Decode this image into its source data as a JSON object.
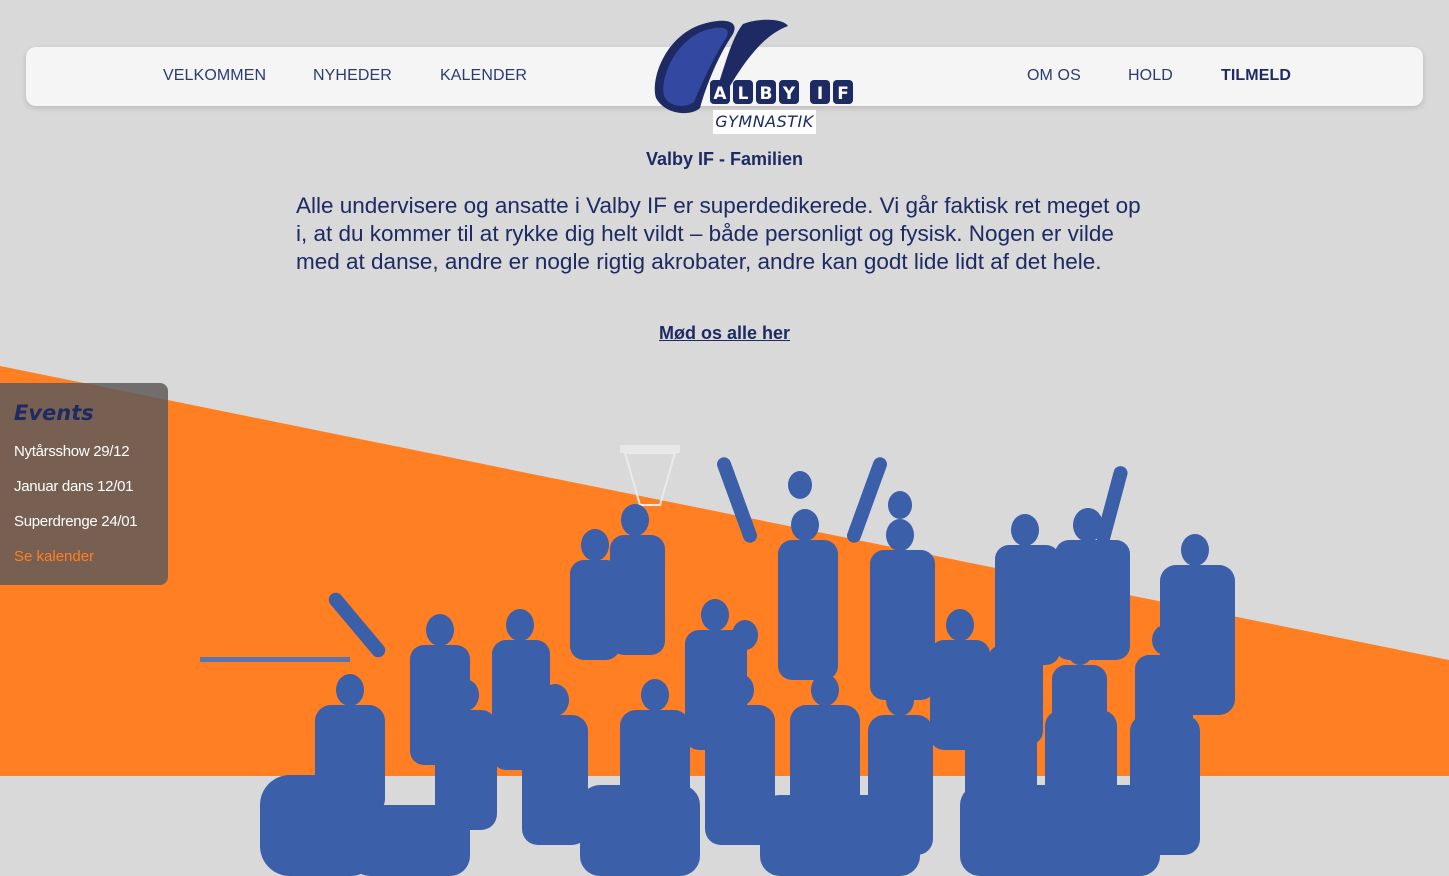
{
  "colors": {
    "background": "#d9d9d9",
    "orange": "#ff7f22",
    "navy": "#1d2a63",
    "navbar": "#f5f5f5",
    "photo_tint": "#3b5fa8"
  },
  "nav": {
    "left": [
      "VELKOMMEN",
      "NYHEDER",
      "KALENDER"
    ],
    "right": [
      "OM OS",
      "HOLD",
      "TILMELD"
    ]
  },
  "logo": {
    "letter": "V",
    "name": "ALBY IF",
    "sub": "GYMNASTIK"
  },
  "main": {
    "title": "Valby IF - Familien",
    "intro": "Alle undervisere og ansatte i Valby IF er superdedikerede. Vi går faktisk ret meget op i, at du kommer til at rykke dig helt vildt – både personligt og fysisk. Nogen er vilde med at danse, andre er nogle rigtig akrobater, andre kan godt lide lidt af det hele.",
    "link": "Mød os alle her"
  },
  "events": {
    "title": "Events",
    "items": [
      "Nytårsshow 29/12",
      "Januar dans 12/01",
      "Superdrenge 24/01"
    ],
    "link": "Se kalender"
  },
  "photo": {
    "icon": "group-photo-icon"
  }
}
